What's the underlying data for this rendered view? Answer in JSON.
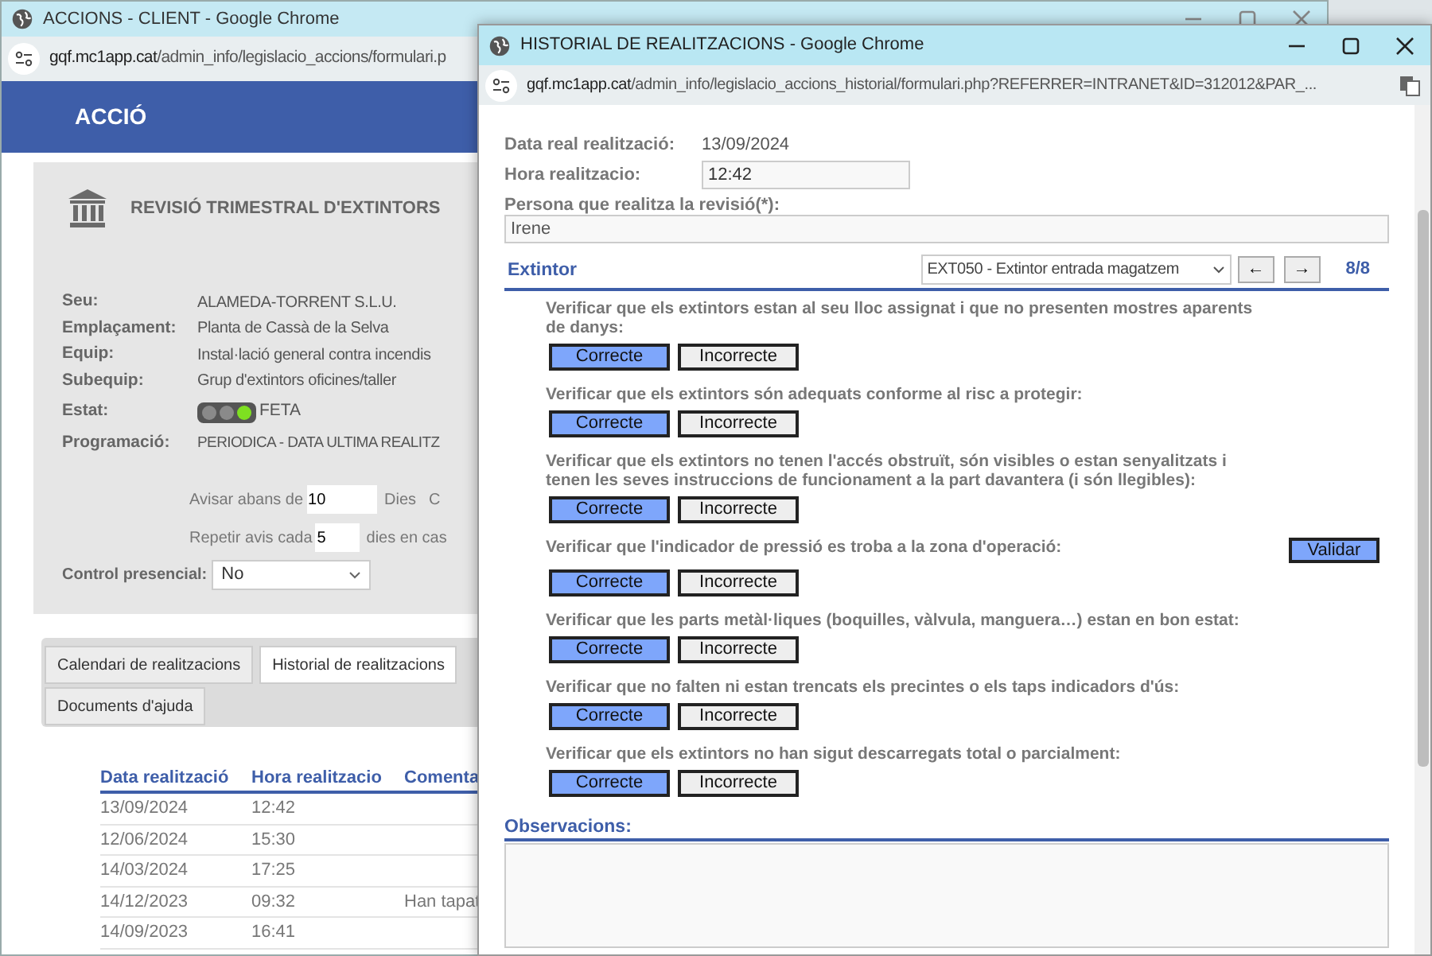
{
  "back_window": {
    "title": "ACCIONS - CLIENT - Google Chrome",
    "url_host": "gqf.mc1app.cat",
    "url_path": "/admin_info/legislacio_accions/formulari.p",
    "header": "ACCIÓ",
    "card_title": "REVISIÓ TRIMESTRAL D'EXTINTORS",
    "fields": [
      {
        "label": "Seu:",
        "value": "ALAMEDA-TORRENT S.L.U."
      },
      {
        "label": "Emplaçament:",
        "value": "Planta de Cassà de la Selva"
      },
      {
        "label": "Equip:",
        "value": "Instal·lació general contra incendis"
      },
      {
        "label": "Subequip:",
        "value": "Grup d'extintors oficines/taller"
      }
    ],
    "status": {
      "label": "Estat:",
      "value": "FETA",
      "lights": [
        {
          "color": "#8a8a8a"
        },
        {
          "color": "#8a8a8a"
        },
        {
          "color": "#7ee021"
        }
      ]
    },
    "programacio": {
      "label": "Programació:",
      "value": "PERIODICA - DATA ULTIMA REALITZ"
    },
    "avisar": {
      "before": "Avisar abans de",
      "value": "10",
      "unit": "Dies",
      "after": "C"
    },
    "repetir": {
      "before": "Repetir avis cada",
      "value": "5",
      "after": "dies en cas"
    },
    "control_presencial": {
      "label": "Control presencial:",
      "value": "No"
    },
    "tabs": [
      {
        "label": "Calendari de realitzacions",
        "selected": false
      },
      {
        "label": "Historial de realitzacions",
        "selected": true
      },
      {
        "label": "Documents d'ajuda",
        "selected": false
      }
    ],
    "table": {
      "columns": [
        "Data realització",
        "Hora realitzacio",
        "Comenta"
      ],
      "rows": [
        [
          "13/09/2024",
          "12:42",
          ""
        ],
        [
          "12/06/2024",
          "15:30",
          ""
        ],
        [
          "14/03/2024",
          "17:25",
          ""
        ],
        [
          "14/12/2023",
          "09:32",
          "Han tapat"
        ],
        [
          "14/09/2023",
          "16:41",
          ""
        ]
      ]
    }
  },
  "popup": {
    "title": "HISTORIAL DE REALITZACIONS - Google Chrome",
    "url_host": "gqf.mc1app.cat",
    "url_path": "/admin_info/legislacio_accions_historial/formulari.php?REFERRER=INTRANET&ID=312012&PAR_...",
    "data_real": {
      "label": "Data real realització:",
      "value": "13/09/2024"
    },
    "hora": {
      "label": "Hora realitzacio:",
      "value": "12:42"
    },
    "persona": {
      "label": "Persona que realitza la revisió(*):",
      "value": "Irene"
    },
    "extintor": {
      "label": "Extintor",
      "selected_option": "EXT050 - Extintor entrada magatzem",
      "prev": "←",
      "next": "→",
      "counter": "8/8"
    },
    "checks": [
      {
        "question": "Verificar que els extintors estan al seu lloc assignat i que no presenten mostres aparents de danys:",
        "options": [
          {
            "label": "Correcte",
            "selected": true
          },
          {
            "label": "Incorrecte",
            "selected": false
          }
        ]
      },
      {
        "question": "Verificar que els extintors són adequats conforme al risc a protegir:",
        "options": [
          {
            "label": "Correcte",
            "selected": true
          },
          {
            "label": "Incorrecte",
            "selected": false
          }
        ]
      },
      {
        "question": "Verificar que els extintors no tenen l'accés obstruït, són visibles o estan senyalitzats i tenen les seves instruccions de funcionament a la part davantera (i són llegibles):",
        "options": [
          {
            "label": "Correcte",
            "selected": true
          },
          {
            "label": "Incorrecte",
            "selected": false
          }
        ]
      },
      {
        "question": "Verificar que l'indicador de pressió es troba a la zona d'operació:",
        "options": [
          {
            "label": "Correcte",
            "selected": true
          },
          {
            "label": "Incorrecte",
            "selected": false
          }
        ]
      },
      {
        "question": "Verificar que les parts metàl·liques (boquilles, vàlvula, manguera…) estan en bon estat:",
        "options": [
          {
            "label": "Correcte",
            "selected": true
          },
          {
            "label": "Incorrecte",
            "selected": false
          }
        ]
      },
      {
        "question": "Verificar que no falten ni estan trencats els precintes o els taps indicadors d'ús:",
        "options": [
          {
            "label": "Correcte",
            "selected": true
          },
          {
            "label": "Incorrecte",
            "selected": false
          }
        ]
      },
      {
        "question": "Verificar que els extintors no han sigut descarregats total o parcialment:",
        "options": [
          {
            "label": "Correcte",
            "selected": true
          },
          {
            "label": "Incorrecte",
            "selected": false
          }
        ]
      }
    ],
    "validate_button": "Validar",
    "observacions": {
      "label": "Observacions:"
    }
  }
}
